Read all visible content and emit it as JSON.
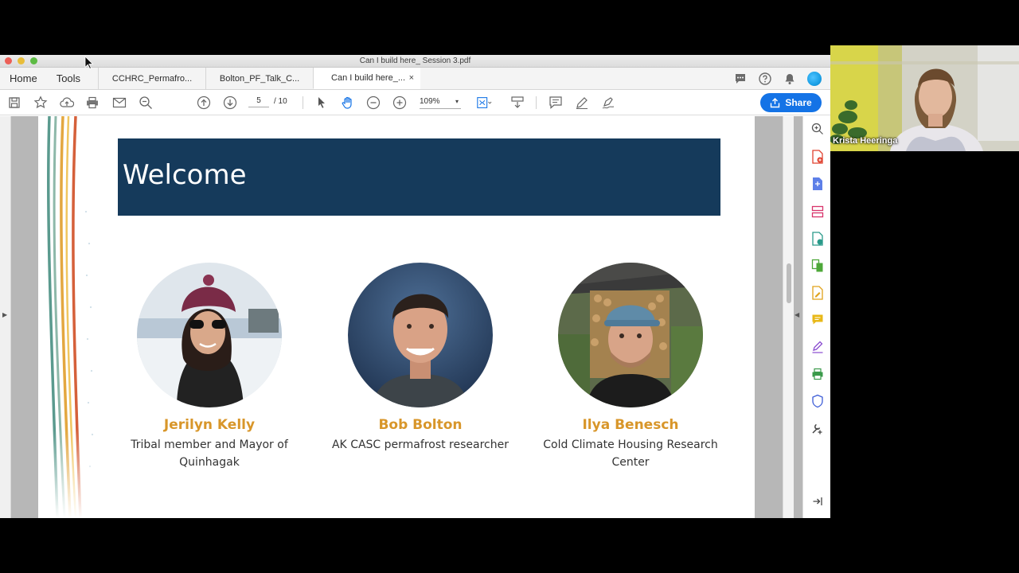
{
  "window": {
    "title": "Can I build here_ Session 3.pdf"
  },
  "nav": {
    "home": "Home",
    "tools": "Tools"
  },
  "tabs": [
    {
      "label": "CCHRC_Permafro..."
    },
    {
      "label": "Bolton_PF_Talk_C..."
    },
    {
      "label": "Can I build here_...",
      "close": "×"
    }
  ],
  "toolbar": {
    "page_current": "5",
    "page_total": "/ 10",
    "zoom": "109%",
    "zoom_caret": "▾",
    "share_label": "Share"
  },
  "slide": {
    "title": "Welcome",
    "people": [
      {
        "name": "Jerilyn Kelly",
        "role": "Tribal member and Mayor of Quinhagak"
      },
      {
        "name": "Bob Bolton",
        "role": "AK CASC permafrost researcher"
      },
      {
        "name": "Ilya Benesch",
        "role": "Cold Climate Housing Research Center"
      }
    ]
  },
  "webcam": {
    "name": "Krista Heeringa"
  },
  "colors": {
    "banner": "#153a5b",
    "name_accent": "#d8962a",
    "share_blue": "#1473e6"
  },
  "icons": [
    "save-icon",
    "star-icon",
    "upload-icon",
    "print-icon",
    "mail-icon",
    "zoom-out-search-icon",
    "page-up-icon",
    "page-down-icon",
    "select-arrow-icon",
    "hand-icon",
    "zoom-minus-icon",
    "zoom-plus-icon",
    "fit-page-icon",
    "scroll-mode-icon",
    "comment-icon",
    "pen-icon",
    "sign-icon",
    "chat-icon",
    "help-icon",
    "bell-icon"
  ]
}
